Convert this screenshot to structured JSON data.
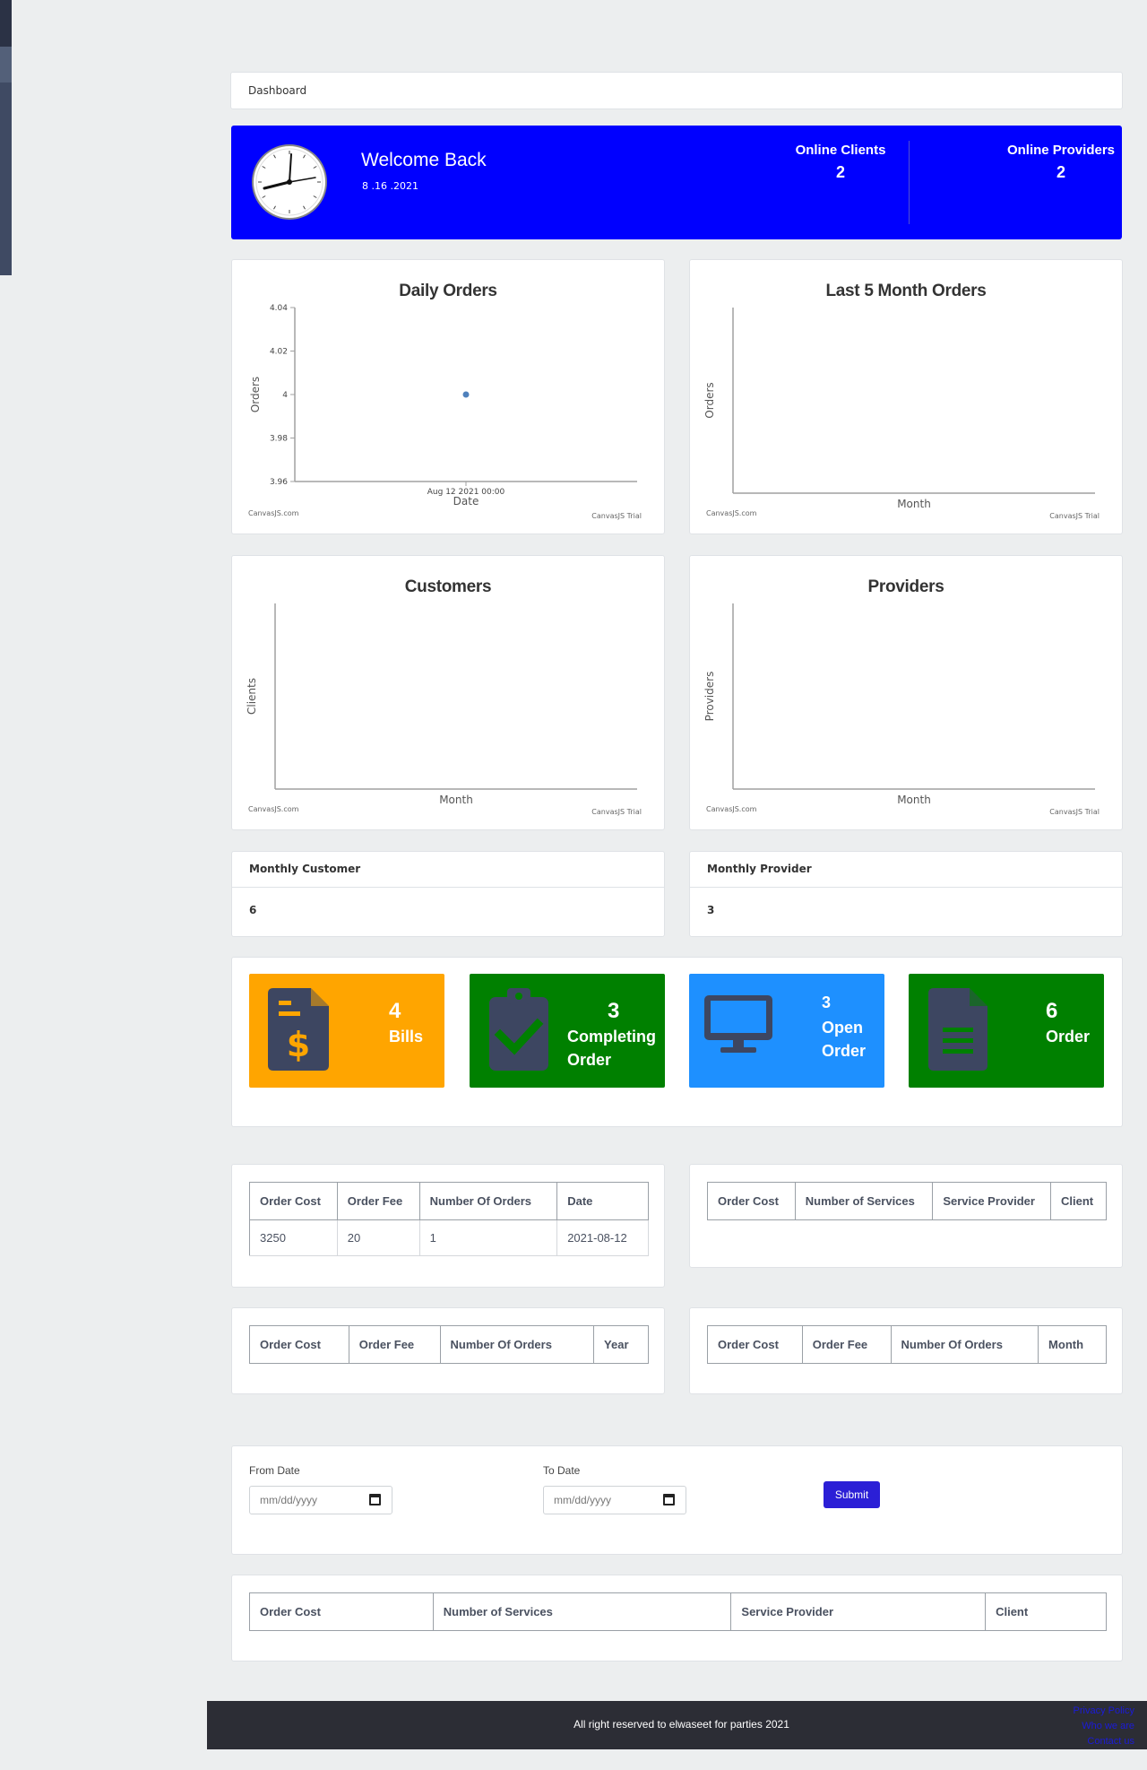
{
  "breadcrumb": "Dashboard",
  "welcome": {
    "title": "Welcome Back",
    "date": "8 .16 .2021",
    "online_clients_label": "Online Clients",
    "online_clients_value": "2",
    "online_providers_label": "Online Providers",
    "online_providers_value": "2"
  },
  "charts": {
    "credit_left": "CanvasJS.com",
    "credit_right": "CanvasJS Trial"
  },
  "chart_data": [
    {
      "type": "scatter",
      "title": "Daily Orders",
      "xlabel": "Date",
      "ylabel": "Orders",
      "x": [
        "Aug 12 2021 00:00"
      ],
      "y": [
        4
      ],
      "yticks": [
        "4.04",
        "4.02",
        "4",
        "3.98",
        "3.96"
      ],
      "ylim": [
        3.96,
        4.04
      ]
    },
    {
      "type": "line",
      "title": "Last 5 Month Orders",
      "xlabel": "Month",
      "ylabel": "Orders",
      "x": [],
      "y": []
    },
    {
      "type": "line",
      "title": "Customers",
      "xlabel": "Month",
      "ylabel": "Clients",
      "x": [],
      "y": []
    },
    {
      "type": "line",
      "title": "Providers",
      "xlabel": "Month",
      "ylabel": "Providers",
      "x": [],
      "y": []
    }
  ],
  "monthly": {
    "customer_label": "Monthly Customer",
    "customer_value": "6",
    "provider_label": "Monthly Provider",
    "provider_value": "3"
  },
  "tiles": [
    {
      "value": "4",
      "label": "Bills",
      "color": "#ffa500",
      "icon": "bill-dollar-icon"
    },
    {
      "value": "3",
      "label": "Completing Order",
      "color": "#008000",
      "icon": "clipboard-check-icon"
    },
    {
      "value": "3",
      "label": "Open Order",
      "color": "#1e90ff",
      "icon": "monitor-icon"
    },
    {
      "value": "6",
      "label": "Order",
      "color": "#008000",
      "icon": "document-icon"
    }
  ],
  "tables": {
    "t1": {
      "headers": [
        "Order Cost",
        "Order Fee",
        "Number Of Orders",
        "Date"
      ],
      "rows": [
        [
          "3250",
          "20",
          "1",
          "2021-08-12"
        ]
      ]
    },
    "t2": {
      "headers": [
        "Order Cost",
        "Number of Services",
        "Service Provider",
        "Client"
      ],
      "rows": []
    },
    "t3": {
      "headers": [
        "Order Cost",
        "Order Fee",
        "Number Of Orders",
        "Year"
      ],
      "rows": []
    },
    "t4": {
      "headers": [
        "Order Cost",
        "Order Fee",
        "Number Of Orders",
        "Month"
      ],
      "rows": []
    },
    "t5": {
      "headers": [
        "Order Cost",
        "Number of Services",
        "Service Provider",
        "Client"
      ],
      "rows": []
    }
  },
  "form": {
    "from_label": "From Date",
    "to_label": "To Date",
    "from_placeholder": "mm/dd/yyyy",
    "to_placeholder": "mm/dd/yyyy",
    "submit_label": "Submit"
  },
  "footer": {
    "text": "All right reserved to elwaseet for parties 2021",
    "links": [
      "Privacy Policy",
      "Who we are",
      "Contact us"
    ]
  },
  "colors": {
    "banner": "#0000ff",
    "submit": "#2b1fd6",
    "footer": "#2c2d35",
    "tile_icon": "#3d4661"
  }
}
